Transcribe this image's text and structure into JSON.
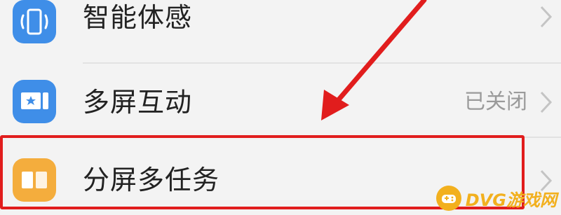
{
  "settings_list": {
    "items": [
      {
        "label": "智能体感",
        "icon": "smart-motion-icon",
        "value": ""
      },
      {
        "label": "多屏互动",
        "icon": "multi-screen-icon",
        "value": "已关闭"
      },
      {
        "label": "分屏多任务",
        "icon": "split-screen-icon",
        "value": ""
      }
    ]
  },
  "annotation": {
    "color": "#e11d1d",
    "target": "分屏多任务"
  },
  "watermark": {
    "text": "DVG游戏网",
    "color": "#f2b01e"
  },
  "colors": {
    "icon_blue": "#3f8ee8",
    "icon_orange": "#f4ad3d",
    "background": "#f3f3f3"
  }
}
